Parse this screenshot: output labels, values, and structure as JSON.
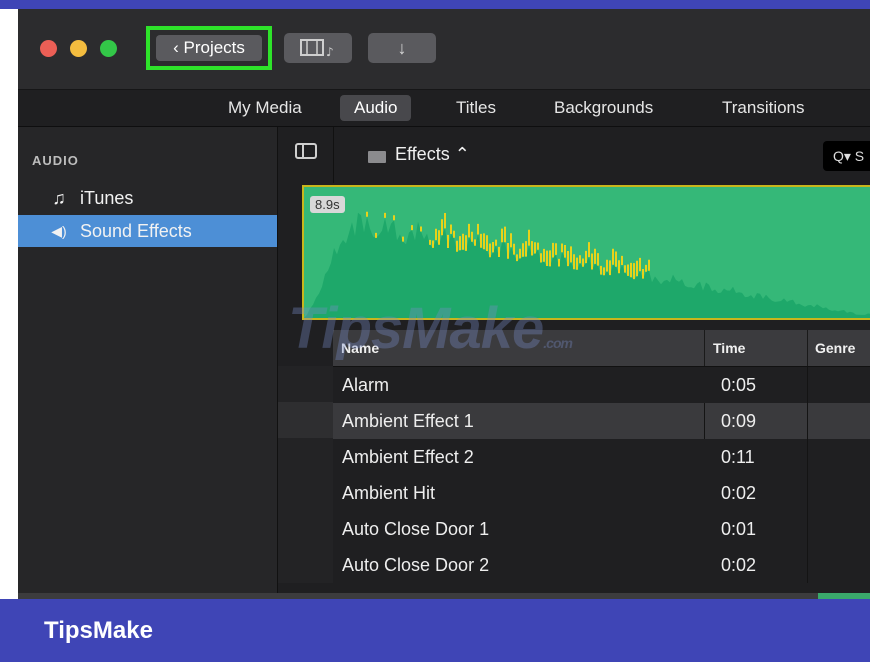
{
  "titlebar": {
    "projects_label": "Projects",
    "projects_icon": "chevron-left-icon",
    "media_icon": "film-music-icon",
    "import_icon": "arrow-down-icon",
    "traffic_lights": [
      "#ec5f56",
      "#f4bd3f",
      "#33c748"
    ]
  },
  "tabs": [
    {
      "label": "My Media",
      "active": false
    },
    {
      "label": "Audio",
      "active": true
    },
    {
      "label": "Titles",
      "active": false
    },
    {
      "label": "Backgrounds",
      "active": false
    },
    {
      "label": "Transitions",
      "active": false
    }
  ],
  "sidebar": {
    "heading": "AUDIO",
    "items": [
      {
        "icon": "music-note-icon",
        "glyph": "♫",
        "label": "iTunes",
        "selected": false
      },
      {
        "icon": "speaker-icon",
        "glyph": "🔊",
        "label": "Sound Effects",
        "selected": true
      }
    ]
  },
  "browser": {
    "folder_label": "Effects ⌃",
    "search_glyph": "Q▾ S"
  },
  "waveform": {
    "duration": "8.9s",
    "colors": {
      "fill": "#1ea86a",
      "peak": "#e8d21a",
      "border": "#c8b61c"
    }
  },
  "table": {
    "columns": [
      "Name",
      "Time",
      "Genre"
    ],
    "rows": [
      {
        "name": "Alarm",
        "time": "0:05",
        "selected": false
      },
      {
        "name": "Ambient Effect 1",
        "time": "0:09",
        "selected": true
      },
      {
        "name": "Ambient Effect 2",
        "time": "0:11",
        "selected": false
      },
      {
        "name": "Ambient Hit",
        "time": "0:02",
        "selected": false
      },
      {
        "name": "Auto Close Door 1",
        "time": "0:01",
        "selected": false
      },
      {
        "name": "Auto Close Door 2",
        "time": "0:02",
        "selected": false
      }
    ]
  },
  "watermark": {
    "text": "TipsMake",
    "suffix": ".com"
  },
  "brand": {
    "label": "TipsMake",
    "color": "#3f45b6"
  }
}
